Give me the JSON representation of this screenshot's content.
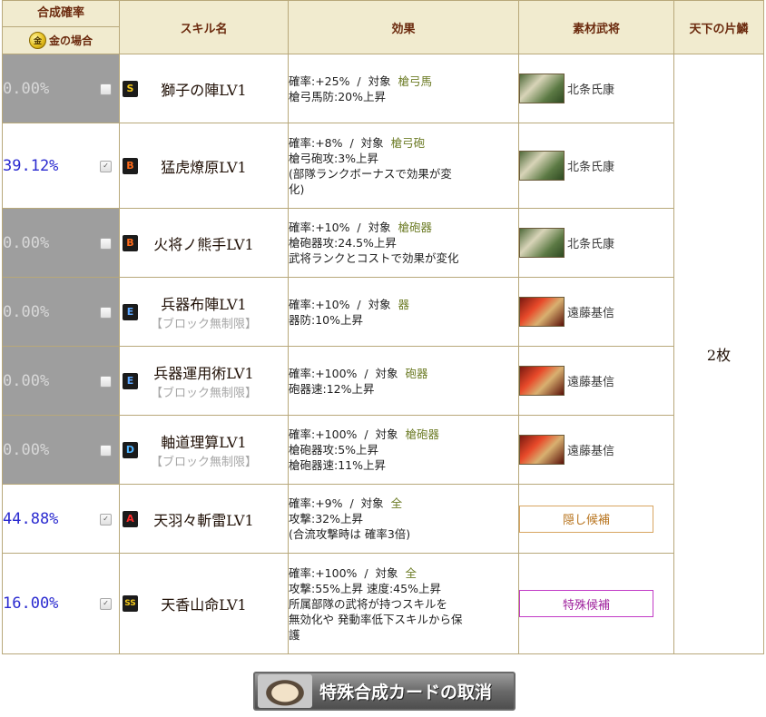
{
  "header": {
    "rate": "合成確率",
    "gold_case": "金の場合",
    "coin_glyph": "金",
    "skill_name": "スキル名",
    "effect": "効果",
    "material": "素材武将",
    "tenka": "天下の片鱗"
  },
  "tenka_value": "2枚",
  "rows": [
    {
      "rate": "0.00%",
      "checked": false,
      "rank": "S",
      "name": "獅子の陣LV1",
      "sub": "",
      "effect": {
        "prob": "確率:+25%",
        "target_label": "対象",
        "target": "槍弓馬",
        "lines": [
          "槍弓馬防:20%上昇"
        ]
      },
      "material": {
        "type": "general",
        "name": "北条氏康",
        "portrait": "green"
      }
    },
    {
      "rate": "39.12%",
      "checked": true,
      "rank": "B",
      "name": "猛虎燎原LV1",
      "sub": "",
      "effect": {
        "prob": "確率:+8%",
        "target_label": "対象",
        "target": "槍弓砲",
        "lines": [
          "槍弓砲攻:3%上昇",
          "(部隊ランクボーナスで効果が変",
          "化)"
        ]
      },
      "material": {
        "type": "general",
        "name": "北条氏康",
        "portrait": "green"
      }
    },
    {
      "rate": "0.00%",
      "checked": false,
      "rank": "B",
      "name": "火将ノ熊手LV1",
      "sub": "",
      "effect": {
        "prob": "確率:+10%",
        "target_label": "対象",
        "target": "槍砲器",
        "lines": [
          "槍砲器攻:24.5%上昇",
          "武将ランクとコストで効果が変化"
        ]
      },
      "material": {
        "type": "general",
        "name": "北条氏康",
        "portrait": "green"
      }
    },
    {
      "rate": "0.00%",
      "checked": false,
      "rank": "E",
      "name": "兵器布陣LV1",
      "sub": "【ブロック無制限】",
      "effect": {
        "prob": "確率:+10%",
        "target_label": "対象",
        "target": "器",
        "lines": [
          "器防:10%上昇"
        ]
      },
      "material": {
        "type": "general",
        "name": "遠藤基信",
        "portrait": "red"
      }
    },
    {
      "rate": "0.00%",
      "checked": false,
      "rank": "E",
      "name": "兵器運用術LV1",
      "sub": "【ブロック無制限】",
      "effect": {
        "prob": "確率:+100%",
        "target_label": "対象",
        "target": "砲器",
        "lines": [
          "砲器速:12%上昇"
        ]
      },
      "material": {
        "type": "general",
        "name": "遠藤基信",
        "portrait": "red"
      }
    },
    {
      "rate": "0.00%",
      "checked": false,
      "rank": "D",
      "name": "軸道理算LV1",
      "sub": "【ブロック無制限】",
      "effect": {
        "prob": "確率:+100%",
        "target_label": "対象",
        "target": "槍砲器",
        "lines": [
          "槍砲器攻:5%上昇",
          "槍砲器速:11%上昇"
        ]
      },
      "material": {
        "type": "general",
        "name": "遠藤基信",
        "portrait": "red"
      }
    },
    {
      "rate": "44.88%",
      "checked": true,
      "rank": "A",
      "name": "天羽々斬雷LV1",
      "sub": "",
      "effect": {
        "prob": "確率:+9%",
        "target_label": "対象",
        "target": "全",
        "lines": [
          "攻撃:32%上昇",
          "(合流攻撃時は 確率3倍)"
        ]
      },
      "material": {
        "type": "hidden",
        "label": "隠し候補"
      }
    },
    {
      "rate": "16.00%",
      "checked": true,
      "rank": "SS",
      "name": "天香山命LV1",
      "sub": "",
      "effect": {
        "prob": "確率:+100%",
        "target_label": "対象",
        "target": "全",
        "lines": [
          "攻撃:55%上昇 速度:45%上昇",
          "所属部隊の武将が持つスキルを",
          "無効化や 発動率低下スキルから保",
          "護"
        ]
      },
      "material": {
        "type": "special",
        "label": "特殊候補"
      }
    }
  ],
  "cancel_button": "特殊合成カードの取消"
}
